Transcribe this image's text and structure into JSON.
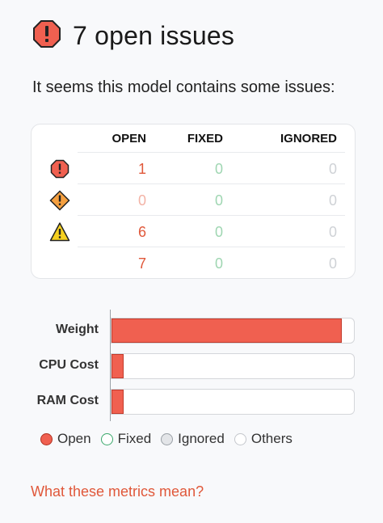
{
  "header": {
    "title": "7 open issues",
    "icon": "error-octagon-icon"
  },
  "subtitle": "It seems this model contains some issues:",
  "table": {
    "columns": [
      "OPEN",
      "FIXED",
      "IGNORED"
    ],
    "rows": [
      {
        "icon": "error-octagon-icon",
        "open": "1",
        "fixed": "0",
        "ignored": "0"
      },
      {
        "icon": "warning-diamond-icon",
        "open": "0",
        "fixed": "0",
        "ignored": "0"
      },
      {
        "icon": "warning-triangle-icon",
        "open": "6",
        "fixed": "0",
        "ignored": "0"
      },
      {
        "icon": "",
        "open": "7",
        "fixed": "0",
        "ignored": "0"
      }
    ]
  },
  "chart_data": {
    "type": "bar",
    "orientation": "horizontal",
    "categories": [
      "Weight",
      "CPU Cost",
      "RAM Cost"
    ],
    "series": [
      {
        "name": "Open",
        "values": [
          0.95,
          0.05,
          0.05
        ]
      },
      {
        "name": "Fixed",
        "values": [
          0,
          0,
          0
        ]
      },
      {
        "name": "Ignored",
        "values": [
          0,
          0,
          0
        ]
      },
      {
        "name": "Others",
        "values": [
          0,
          0,
          0
        ]
      }
    ],
    "xlim": [
      0,
      1
    ],
    "legend": "bottom"
  },
  "legend": [
    {
      "label": "Open",
      "color": "#f06050",
      "border": "#b03020"
    },
    {
      "label": "Fixed",
      "color": "#ffffff",
      "border": "#3aa86b"
    },
    {
      "label": "Ignored",
      "color": "#e3e5e8",
      "border": "#9aa0a6"
    },
    {
      "label": "Others",
      "color": "#ffffff",
      "border": "#c4c7cc"
    }
  ],
  "link": "What these metrics mean?",
  "colors": {
    "open": "#e0583a",
    "open_zero": "#f3b3a6",
    "fixed": "#9fd6b2",
    "ignored": "#cfd2d6",
    "accent": "#e0583a"
  }
}
